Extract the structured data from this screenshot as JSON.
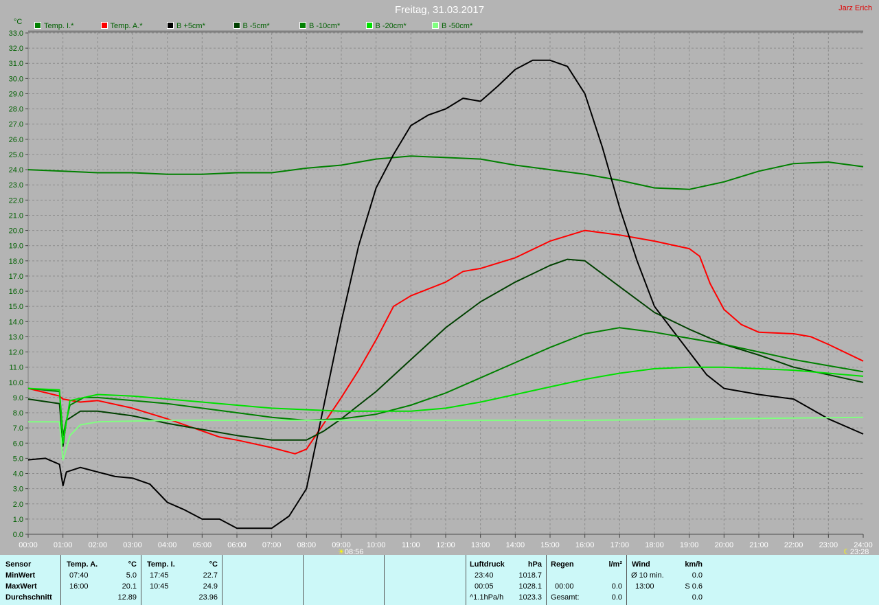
{
  "header": {
    "title": "Freitag, 31.03.2017",
    "author": "Jarz Erich",
    "unit": "°C"
  },
  "markers": {
    "sunrise": "08:56",
    "sunset": "23:28"
  },
  "chart_data": {
    "type": "line",
    "title": "Freitag, 31.03.2017",
    "ylabel": "°C",
    "xlabel": "",
    "ylim": [
      0,
      33
    ],
    "xlim": [
      0,
      24
    ],
    "grid": true,
    "legend_placement": "top",
    "x_tick_labels": [
      "00:00",
      "01:00",
      "02:00",
      "03:00",
      "04:00",
      "05:00",
      "06:00",
      "07:00",
      "08:00",
      "09:00",
      "10:00",
      "11:00",
      "12:00",
      "13:00",
      "14:00",
      "15:00",
      "16:00",
      "17:00",
      "18:00",
      "19:00",
      "20:00",
      "21:00",
      "22:00",
      "23:00",
      "24:00"
    ],
    "series": [
      {
        "name": "Temp. I.*",
        "color": "#008000",
        "points": [
          [
            0,
            24.0
          ],
          [
            1,
            23.9
          ],
          [
            2,
            23.8
          ],
          [
            3,
            23.8
          ],
          [
            4,
            23.7
          ],
          [
            5,
            23.7
          ],
          [
            6,
            23.8
          ],
          [
            7,
            23.8
          ],
          [
            8,
            24.1
          ],
          [
            9,
            24.3
          ],
          [
            10,
            24.7
          ],
          [
            11,
            24.9
          ],
          [
            12,
            24.8
          ],
          [
            13,
            24.7
          ],
          [
            14,
            24.3
          ],
          [
            15,
            24.0
          ],
          [
            16,
            23.7
          ],
          [
            17,
            23.3
          ],
          [
            18,
            22.8
          ],
          [
            19,
            22.7
          ],
          [
            20,
            23.2
          ],
          [
            21,
            23.9
          ],
          [
            22,
            24.4
          ],
          [
            23,
            24.5
          ],
          [
            24,
            24.2
          ]
        ]
      },
      {
        "name": "Temp. A.*",
        "color": "#ff0000",
        "points": [
          [
            0,
            9.6
          ],
          [
            0.9,
            9.1
          ],
          [
            1,
            8.9
          ],
          [
            1.5,
            8.7
          ],
          [
            2,
            8.8
          ],
          [
            3,
            8.3
          ],
          [
            4,
            7.6
          ],
          [
            5,
            6.8
          ],
          [
            5.5,
            6.4
          ],
          [
            6,
            6.2
          ],
          [
            7,
            5.7
          ],
          [
            7.67,
            5.3
          ],
          [
            8,
            5.6
          ],
          [
            8.5,
            7.3
          ],
          [
            9,
            9.0
          ],
          [
            9.5,
            10.8
          ],
          [
            10,
            12.8
          ],
          [
            10.5,
            15.0
          ],
          [
            11,
            15.7
          ],
          [
            12,
            16.6
          ],
          [
            12.5,
            17.3
          ],
          [
            13,
            17.5
          ],
          [
            14,
            18.2
          ],
          [
            15,
            19.3
          ],
          [
            16,
            20.0
          ],
          [
            17,
            19.7
          ],
          [
            18,
            19.3
          ],
          [
            19,
            18.8
          ],
          [
            19.3,
            18.3
          ],
          [
            19.6,
            16.5
          ],
          [
            20,
            14.8
          ],
          [
            20.5,
            13.8
          ],
          [
            21,
            13.3
          ],
          [
            22,
            13.2
          ],
          [
            22.5,
            13.0
          ],
          [
            23,
            12.5
          ],
          [
            24,
            11.4
          ]
        ]
      },
      {
        "name": "B +5cm*",
        "color": "#000000",
        "points": [
          [
            0,
            4.9
          ],
          [
            0.5,
            5.0
          ],
          [
            0.9,
            4.6
          ],
          [
            1,
            3.2
          ],
          [
            1.1,
            4.1
          ],
          [
            1.5,
            4.4
          ],
          [
            2,
            4.1
          ],
          [
            2.5,
            3.8
          ],
          [
            3,
            3.7
          ],
          [
            3.5,
            3.3
          ],
          [
            4,
            2.1
          ],
          [
            4.5,
            1.6
          ],
          [
            5,
            1.0
          ],
          [
            5.5,
            1.0
          ],
          [
            6,
            0.4
          ],
          [
            7,
            0.4
          ],
          [
            7.5,
            1.2
          ],
          [
            8,
            3.0
          ],
          [
            8.5,
            8.5
          ],
          [
            9,
            14.0
          ],
          [
            9.5,
            19.0
          ],
          [
            10,
            22.8
          ],
          [
            10.5,
            25.0
          ],
          [
            11,
            26.9
          ],
          [
            11.5,
            27.6
          ],
          [
            12,
            28.0
          ],
          [
            12.5,
            28.7
          ],
          [
            13,
            28.5
          ],
          [
            13.5,
            29.5
          ],
          [
            14,
            30.6
          ],
          [
            14.5,
            31.2
          ],
          [
            15,
            31.2
          ],
          [
            15.5,
            30.8
          ],
          [
            16,
            29.0
          ],
          [
            16.5,
            25.5
          ],
          [
            17,
            21.5
          ],
          [
            17.5,
            18.0
          ],
          [
            18,
            15.0
          ],
          [
            18.5,
            13.5
          ],
          [
            19,
            12.0
          ],
          [
            19.5,
            10.5
          ],
          [
            20,
            9.6
          ],
          [
            21,
            9.2
          ],
          [
            22,
            8.9
          ],
          [
            23,
            7.6
          ],
          [
            24,
            6.6
          ]
        ]
      },
      {
        "name": "B -5cm*",
        "color": "#004000",
        "points": [
          [
            0,
            8.9
          ],
          [
            0.9,
            8.6
          ],
          [
            1,
            5.8
          ],
          [
            1.1,
            7.5
          ],
          [
            1.5,
            8.1
          ],
          [
            2,
            8.1
          ],
          [
            3,
            7.8
          ],
          [
            4,
            7.3
          ],
          [
            5,
            6.9
          ],
          [
            6,
            6.5
          ],
          [
            7,
            6.2
          ],
          [
            8,
            6.2
          ],
          [
            8.5,
            6.8
          ],
          [
            9,
            7.6
          ],
          [
            10,
            9.4
          ],
          [
            11,
            11.5
          ],
          [
            12,
            13.6
          ],
          [
            13,
            15.3
          ],
          [
            14,
            16.6
          ],
          [
            15,
            17.7
          ],
          [
            15.5,
            18.1
          ],
          [
            16,
            18.0
          ],
          [
            17,
            16.3
          ],
          [
            18,
            14.6
          ],
          [
            19,
            13.5
          ],
          [
            20,
            12.5
          ],
          [
            21,
            11.8
          ],
          [
            22,
            11.0
          ],
          [
            23,
            10.5
          ],
          [
            24,
            10.0
          ]
        ]
      },
      {
        "name": "B -10cm*",
        "color": "#008000",
        "points": [
          [
            0,
            9.6
          ],
          [
            0.9,
            9.4
          ],
          [
            1,
            6.5
          ],
          [
            1.2,
            8.5
          ],
          [
            1.6,
            9.0
          ],
          [
            2,
            9.0
          ],
          [
            3,
            8.8
          ],
          [
            4,
            8.6
          ],
          [
            5,
            8.3
          ],
          [
            6,
            8.0
          ],
          [
            7,
            7.7
          ],
          [
            8,
            7.5
          ],
          [
            9,
            7.6
          ],
          [
            10,
            7.9
          ],
          [
            11,
            8.5
          ],
          [
            12,
            9.3
          ],
          [
            13,
            10.3
          ],
          [
            14,
            11.3
          ],
          [
            15,
            12.3
          ],
          [
            16,
            13.2
          ],
          [
            17,
            13.6
          ],
          [
            18,
            13.3
          ],
          [
            19,
            12.9
          ],
          [
            20,
            12.5
          ],
          [
            21,
            12.0
          ],
          [
            22,
            11.5
          ],
          [
            23,
            11.1
          ],
          [
            24,
            10.7
          ]
        ]
      },
      {
        "name": "B -20cm*",
        "color": "#00e000",
        "points": [
          [
            0,
            9.6
          ],
          [
            0.9,
            9.5
          ],
          [
            1,
            6.0
          ],
          [
            1.2,
            8.8
          ],
          [
            2,
            9.2
          ],
          [
            3,
            9.1
          ],
          [
            4,
            8.9
          ],
          [
            5,
            8.7
          ],
          [
            6,
            8.5
          ],
          [
            7,
            8.3
          ],
          [
            8,
            8.2
          ],
          [
            9,
            8.1
          ],
          [
            10,
            8.1
          ],
          [
            11,
            8.1
          ],
          [
            12,
            8.3
          ],
          [
            13,
            8.7
          ],
          [
            14,
            9.2
          ],
          [
            15,
            9.7
          ],
          [
            16,
            10.2
          ],
          [
            17,
            10.6
          ],
          [
            18,
            10.9
          ],
          [
            19,
            11.0
          ],
          [
            20,
            11.0
          ],
          [
            21,
            10.9
          ],
          [
            22,
            10.8
          ],
          [
            23,
            10.6
          ],
          [
            24,
            10.4
          ]
        ]
      },
      {
        "name": "B -50cm*",
        "color": "#80ff80",
        "points": [
          [
            0,
            7.4
          ],
          [
            0.9,
            7.4
          ],
          [
            1,
            4.9
          ],
          [
            1.2,
            6.5
          ],
          [
            1.5,
            7.2
          ],
          [
            2,
            7.4
          ],
          [
            4,
            7.5
          ],
          [
            8,
            7.5
          ],
          [
            12,
            7.5
          ],
          [
            16,
            7.5
          ],
          [
            20,
            7.6
          ],
          [
            24,
            7.7
          ]
        ]
      }
    ]
  },
  "table": {
    "sensor_col": [
      "Sensor",
      "MinWert",
      "MaxWert",
      "Durchschnitt"
    ],
    "temp_a": {
      "header": "Temp. A.",
      "unit": "°C",
      "min_time": "07:40",
      "min": "5.0",
      "max_time": "16:00",
      "max": "20.1",
      "avg": "12.89"
    },
    "temp_i": {
      "header": "Temp. I.",
      "unit": "°C",
      "min_time": "17:45",
      "min": "22.7",
      "max_time": "10:45",
      "max": "24.9",
      "avg": "23.96"
    },
    "pressure": {
      "header": "Luftdruck",
      "unit": "hPa",
      "r1_label": "23:40",
      "r1": "1018.7",
      "r2_label": "00:05",
      "r2": "1028.1",
      "r3_label": "^1.1hPa/h",
      "r3": "1023.3"
    },
    "rain": {
      "header": "Regen",
      "unit": "l/m²",
      "r2_label": "00:00",
      "r2": "0.0",
      "r3_label": "Gesamt:",
      "r3": "0.0"
    },
    "wind": {
      "header": "Wind",
      "unit": "km/h",
      "r1_label": "Ø 10 min.",
      "r1": "0.0",
      "r2_label": "13:00",
      "r2": "S 0.6",
      "r3": "0.0"
    }
  }
}
